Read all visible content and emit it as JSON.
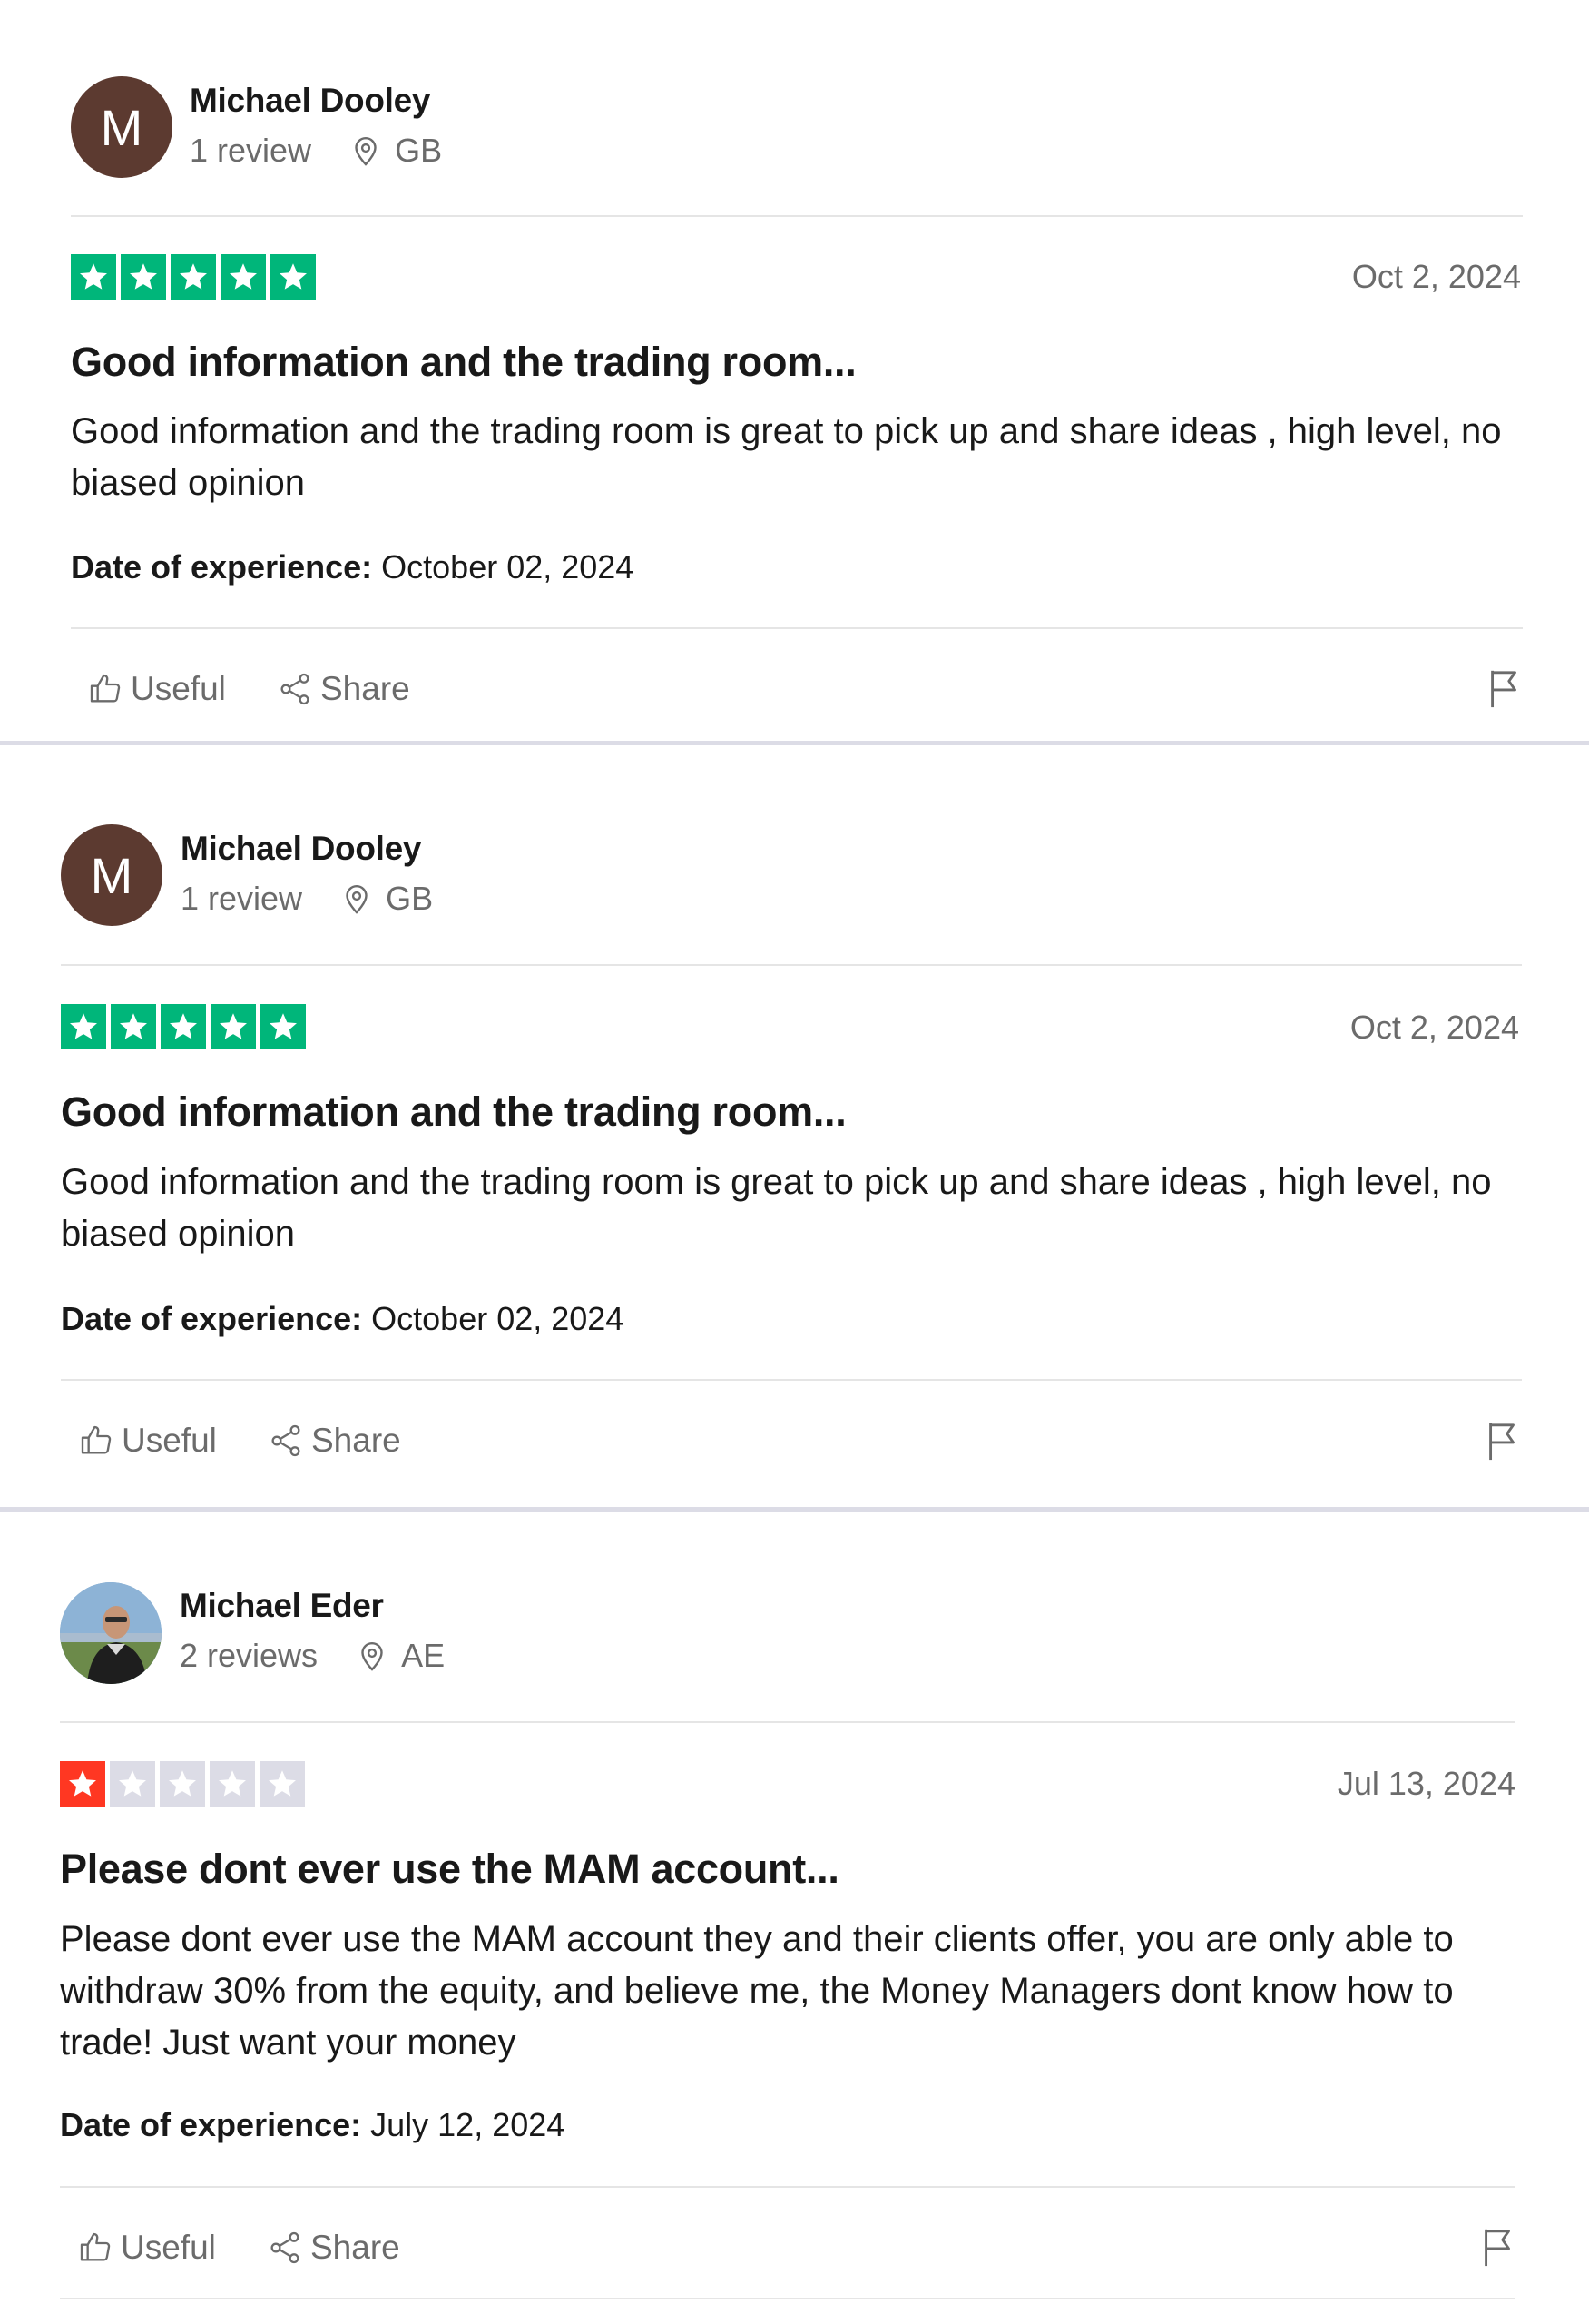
{
  "reviews": [
    {
      "avatar_initial": "M",
      "name": "Michael Dooley",
      "review_count": "1 review",
      "country": "GB",
      "rating": 5,
      "star_color": "#00b67a",
      "date": "Oct 2, 2024",
      "title": "Good information and the trading room...",
      "body": "Good information and the trading room is great to pick up and share ideas , high level, no biased opinion",
      "experience_label": "Date of experience:",
      "experience_date": "October 02, 2024",
      "useful_label": "Useful",
      "share_label": "Share"
    },
    {
      "avatar_initial": "M",
      "name": "Michael Dooley",
      "review_count": "1 review",
      "country": "GB",
      "rating": 5,
      "star_color": "#00b67a",
      "date": "Oct 2, 2024",
      "title": "Good information and the trading room...",
      "body": "Good information and the trading room is great to pick up and share ideas , high level, no biased opinion",
      "experience_label": "Date of experience:",
      "experience_date": "October 02, 2024",
      "useful_label": "Useful",
      "share_label": "Share"
    },
    {
      "avatar_initial": "",
      "name": "Michael Eder",
      "review_count": "2 reviews",
      "country": "AE",
      "rating": 1,
      "star_color": "#ff3722",
      "date": "Jul 13, 2024",
      "title": "Please dont ever use the MAM account...",
      "body": "Please dont ever use the MAM account they and their clients offer, you are only able to withdraw 30% from the equity, and believe me, the Money Managers dont know how to trade! Just want your money",
      "experience_label": "Date of experience:",
      "experience_date": "July 12, 2024",
      "useful_label": "Useful",
      "share_label": "Share"
    }
  ],
  "colors": {
    "avatar_bg": "#5c3a30",
    "empty_star": "#dcdce6",
    "muted_text": "#6b6b6b"
  },
  "icons": [
    "location-pin-icon",
    "thumbs-up-icon",
    "share-icon",
    "flag-icon",
    "star-icon"
  ]
}
